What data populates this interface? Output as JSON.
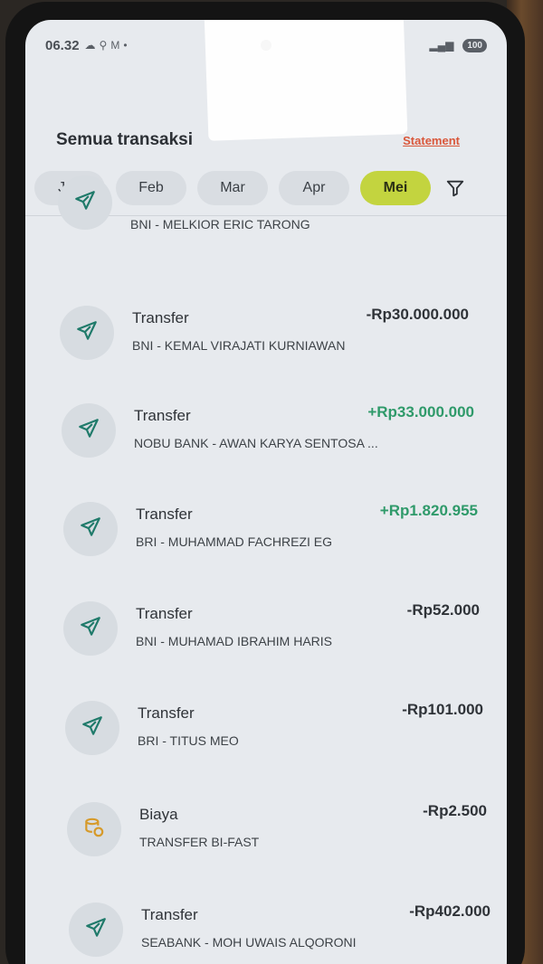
{
  "status_bar": {
    "time": "06.32",
    "notification_icons": [
      "cloud-icon",
      "maps-pin-icon",
      "gmail-icon",
      "dot-icon"
    ],
    "battery": "100"
  },
  "header": {
    "title": "Semua transaksi",
    "statement_link": "Statement"
  },
  "months": {
    "items": [
      "Jan",
      "Feb",
      "Mar",
      "Apr",
      "Mei"
    ],
    "selected": "Mei"
  },
  "filter_icon": "filter-icon",
  "transactions": [
    {
      "type": "",
      "description": "BNI - MELKIOR ERIC TARONG",
      "amount": "",
      "icon": "send-icon"
    },
    {
      "type": "Transfer",
      "description": "BNI - KEMAL VIRAJATI KURNIAWAN",
      "amount": "-Rp30.000.000",
      "icon": "send-icon"
    },
    {
      "type": "Transfer",
      "description": "NOBU BANK - AWAN KARYA SENTOSA ...",
      "amount": "+Rp33.000.000",
      "icon": "send-icon"
    },
    {
      "type": "Transfer",
      "description": "BRI - MUHAMMAD FACHREZI EG",
      "amount": "+Rp1.820.955",
      "icon": "send-icon"
    },
    {
      "type": "Transfer",
      "description": "BNI - MUHAMAD IBRAHIM HARIS",
      "amount": "-Rp52.000",
      "icon": "send-icon"
    },
    {
      "type": "Transfer",
      "description": "BRI - TITUS MEO",
      "amount": "-Rp101.000",
      "icon": "send-icon"
    },
    {
      "type": "Biaya",
      "description": "TRANSFER BI-FAST",
      "amount": "-Rp2.500",
      "icon": "coins-icon"
    },
    {
      "type": "Transfer",
      "description": "SEABANK - MOH UWAIS ALQORONI",
      "amount": "-Rp402.000",
      "icon": "send-icon"
    }
  ],
  "colors": {
    "positive_amount": "#2f9a6a",
    "negative_amount": "#2f3338",
    "selected_month": "#c3d43f",
    "statement_link": "#d9573a",
    "send_icon": "#1f7a6a",
    "coins_icon": "#d69a2a"
  }
}
